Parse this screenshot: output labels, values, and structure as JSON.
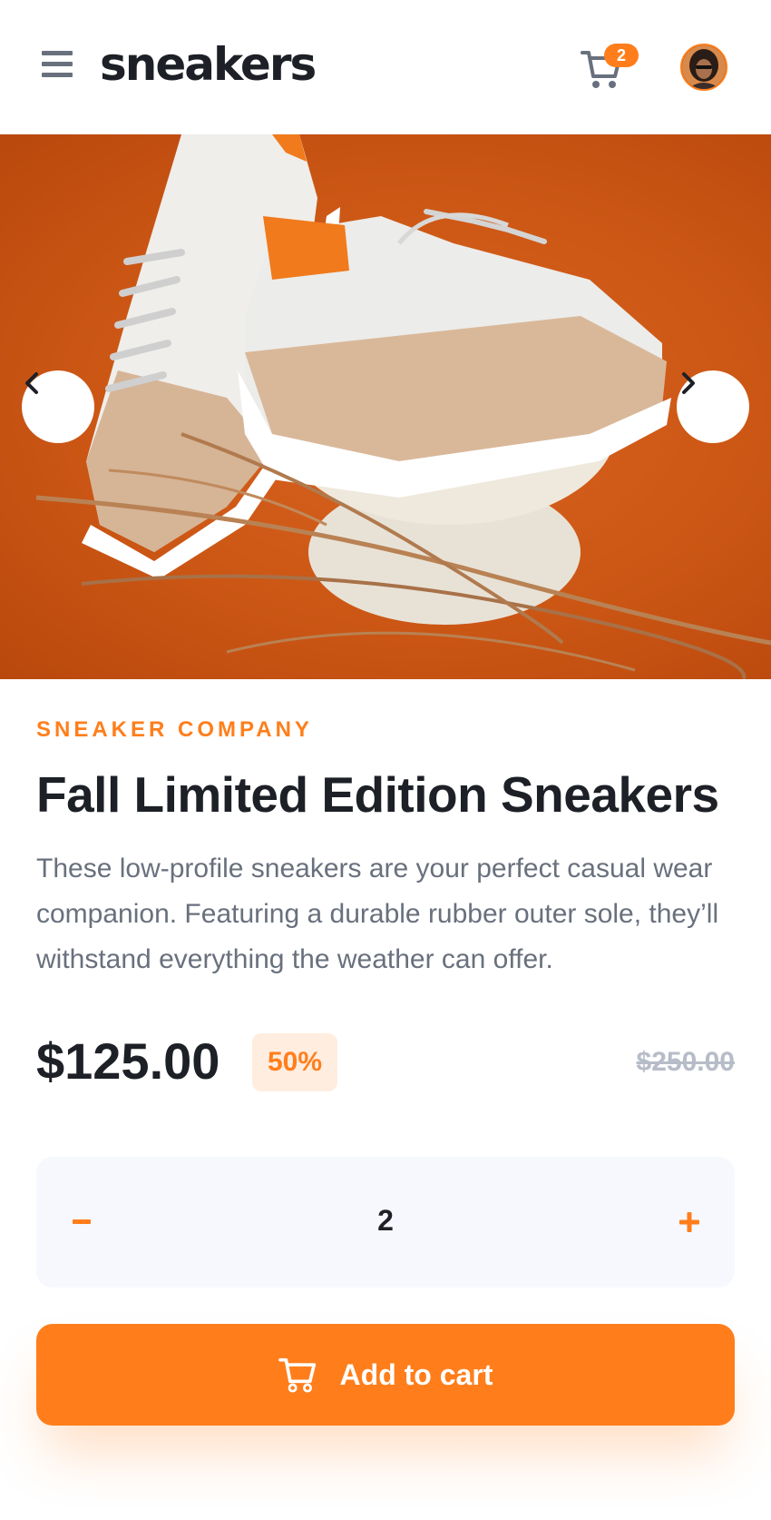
{
  "header": {
    "logo": "sneakers",
    "cart_count": "2"
  },
  "product": {
    "company": "Sneaker Company",
    "title": "Fall Limited Edition Sneakers",
    "description": "These low-profile sneakers are your perfect casual wear companion. Featuring a durable rubber outer sole, they’ll withstand everything the weather can offer.",
    "price": "$125.00",
    "discount": "50%",
    "original_price": "$250.00"
  },
  "quantity": {
    "value": "2"
  },
  "actions": {
    "add_to_cart_label": "Add to cart"
  },
  "colors": {
    "accent": "#ff7e1b",
    "accent_pale": "#ffede0",
    "text_dark": "#1d2026",
    "text_muted": "#69707d",
    "text_light": "#b6bcc8",
    "qty_background": "#f6f8fd"
  },
  "icons": [
    "menu-icon",
    "cart-icon",
    "chevron-left-icon",
    "chevron-right-icon",
    "minus-icon",
    "plus-icon"
  ]
}
